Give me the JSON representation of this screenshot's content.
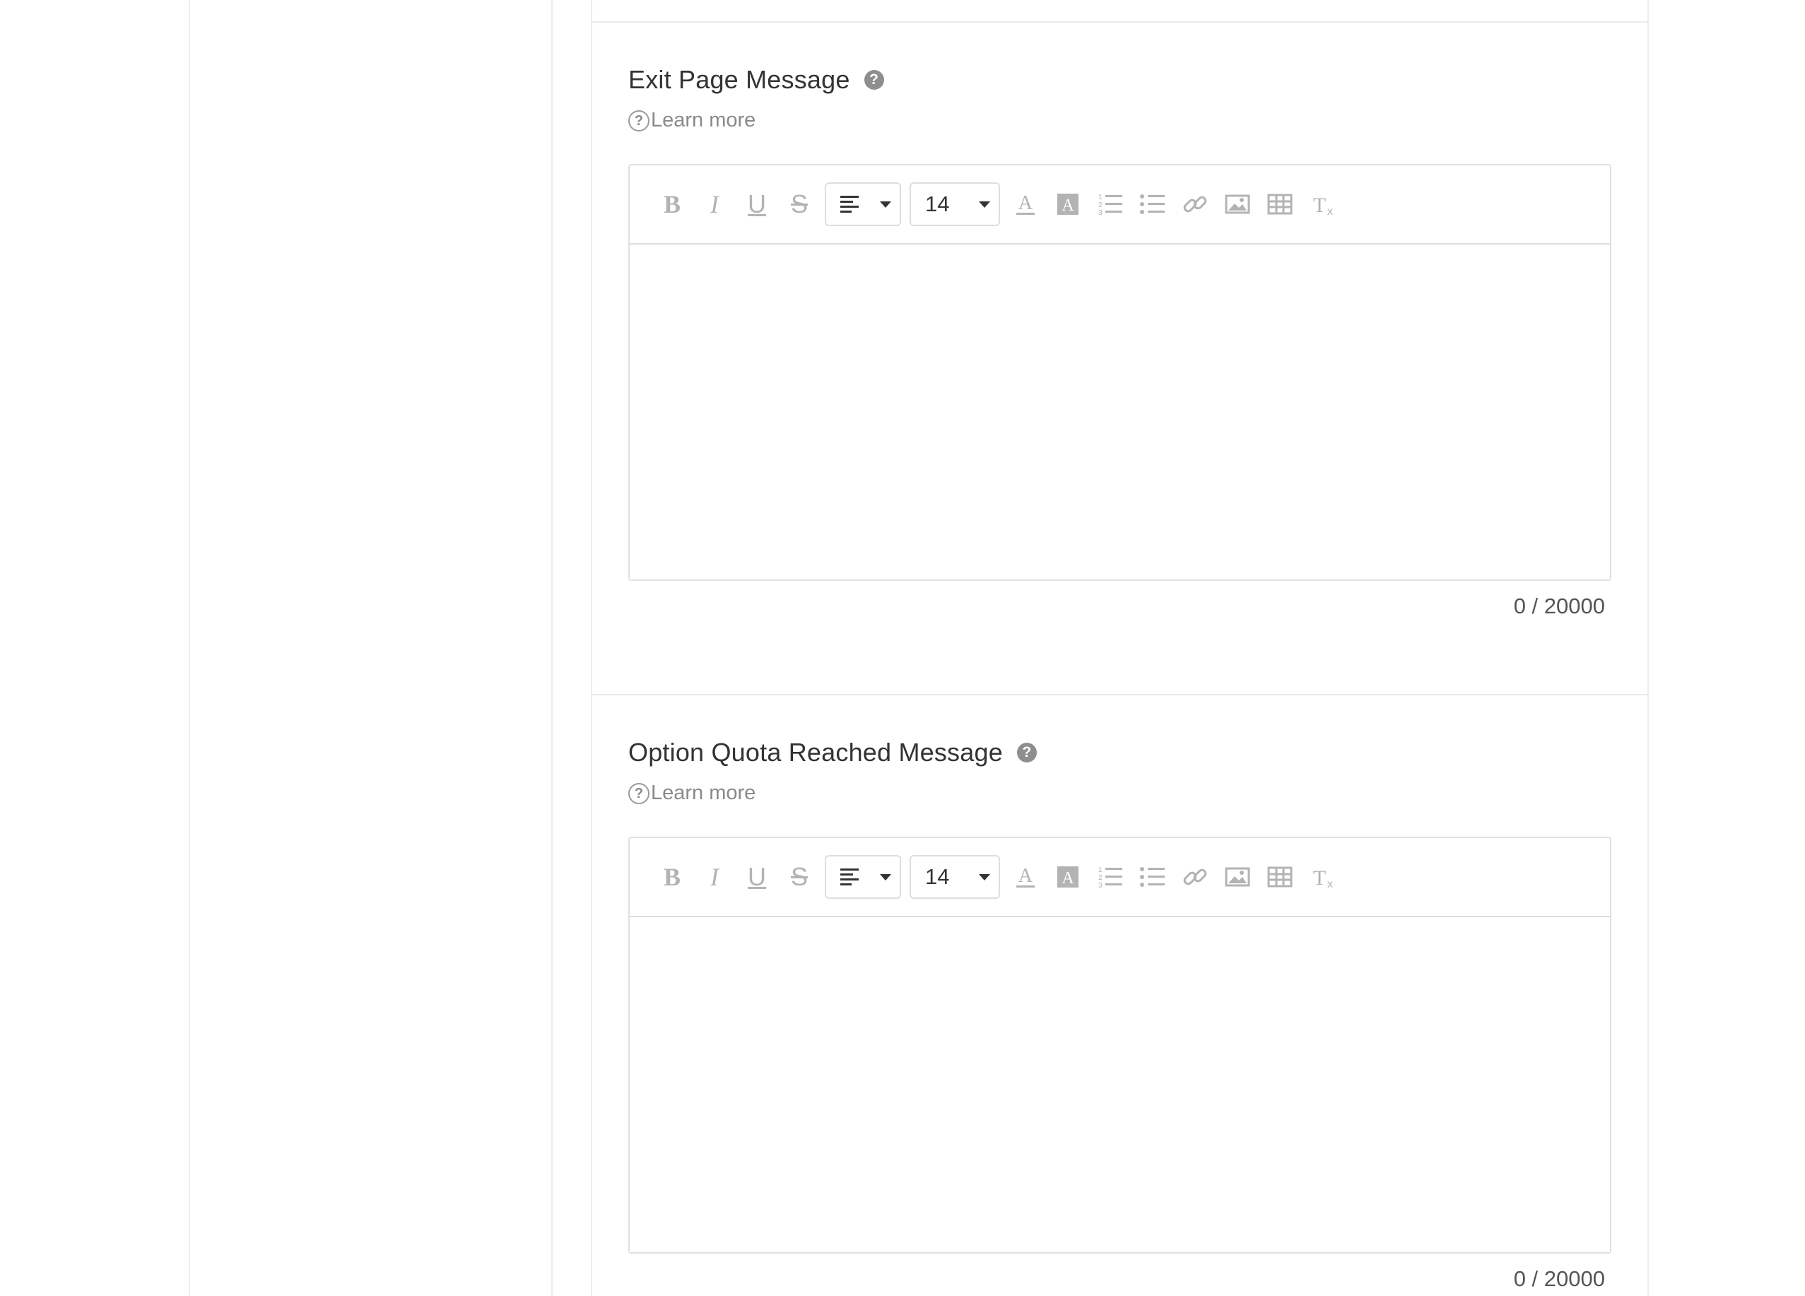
{
  "sections": [
    {
      "title": "Exit Page Message",
      "help_icon": "question-circle-icon",
      "learn_more": "Learn more",
      "editor": {
        "font_size": "14",
        "content": ""
      },
      "counter": "0 / 20000"
    },
    {
      "title": "Option Quota Reached Message",
      "help_icon": "question-circle-icon",
      "learn_more": "Learn more",
      "editor": {
        "font_size": "14",
        "content": ""
      },
      "counter": "0 / 20000"
    }
  ],
  "toolbar_icons": [
    "bold-icon",
    "italic-icon",
    "underline-icon",
    "strikethrough-icon",
    "align-left-icon",
    "font-color-icon",
    "background-color-icon",
    "ordered-list-icon",
    "bullet-list-icon",
    "link-icon",
    "image-icon",
    "table-icon",
    "clear-format-icon"
  ],
  "colors": {
    "title": "#333333",
    "muted": "#8a8a8a",
    "icon": "#b3b3b3",
    "border": "#e0e0e0"
  }
}
